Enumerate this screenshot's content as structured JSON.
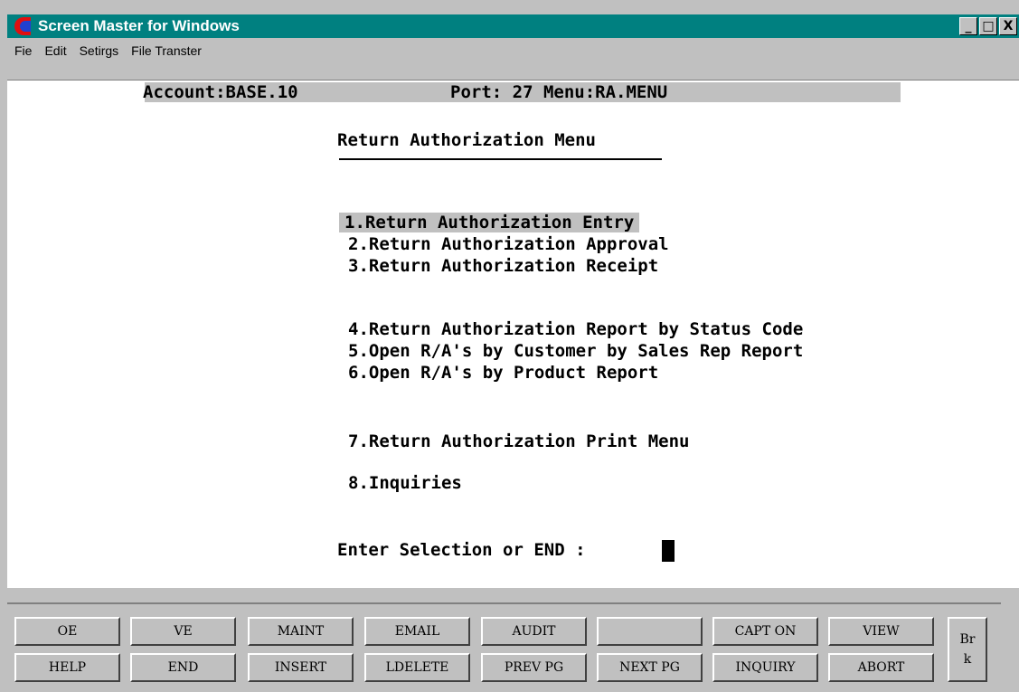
{
  "window": {
    "title": "Screen Master for Windows",
    "minimize_label": "_",
    "maximize_label": "□",
    "close_label": "X"
  },
  "menubar": {
    "items": [
      "Fie",
      "Edit",
      "Setirgs",
      "File Transter"
    ]
  },
  "terminal": {
    "account_line": "Account:BASE.10",
    "port_line": "Port: 27 Menu:RA.MENU",
    "menu_title": "Return Authorization Menu",
    "options": [
      "1.Return Authorization Entry",
      "2.Return Authorization Approval",
      "3.Return Authorization Receipt",
      "4.Return Authorization Report by Status Code",
      "5.Open R/A's by Customer by Sales Rep Report",
      "6.Open R/A's by Product Report",
      "7.Return Authorization Print Menu",
      "8.Inquiries"
    ],
    "prompt": "Enter Selection or END : "
  },
  "function_keys": {
    "row1": [
      "OE",
      "VE",
      "MAINT",
      "EMAIL",
      "AUDIT",
      "",
      "CAPT ON",
      "VIEW"
    ],
    "row2": [
      "HELP",
      "END",
      "INSERT",
      "LDELETE",
      "PREV PG",
      "NEXT PG",
      "INQUIRY",
      "ABORT"
    ],
    "break_top": "Br",
    "break_bottom": "k"
  }
}
